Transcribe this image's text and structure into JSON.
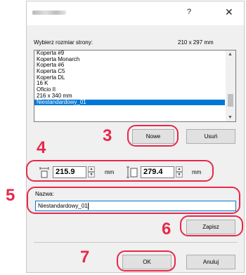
{
  "dialog": {
    "help_glyph": "?",
    "close_glyph": "✕"
  },
  "page_size": {
    "label": "Wybierz rozmiar strony:",
    "current": "210 x 297 mm",
    "items": [
      "Koperta #9",
      "Koperta Monarch",
      "Koperta #6",
      "Koperta C5",
      "Koperta DL",
      "16 K",
      "Oficio II",
      "216 x 340 mm",
      "Niestandardowy_01"
    ],
    "selected_index": 8
  },
  "buttons": {
    "new": "Nowe",
    "delete": "Usuń",
    "save": "Zapisz",
    "ok": "OK",
    "cancel": "Anuluj"
  },
  "dimensions": {
    "width_value": "215.9",
    "width_unit": "mm",
    "height_value": "279.4",
    "height_unit": "mm"
  },
  "name": {
    "label": "Nazwa:",
    "value": "Niestandardowy_01"
  },
  "steps": {
    "s3": "3",
    "s4": "4",
    "s5": "5",
    "s6": "6",
    "s7": "7"
  },
  "colors": {
    "highlight": "#e8284a",
    "selection": "#0078d7"
  }
}
